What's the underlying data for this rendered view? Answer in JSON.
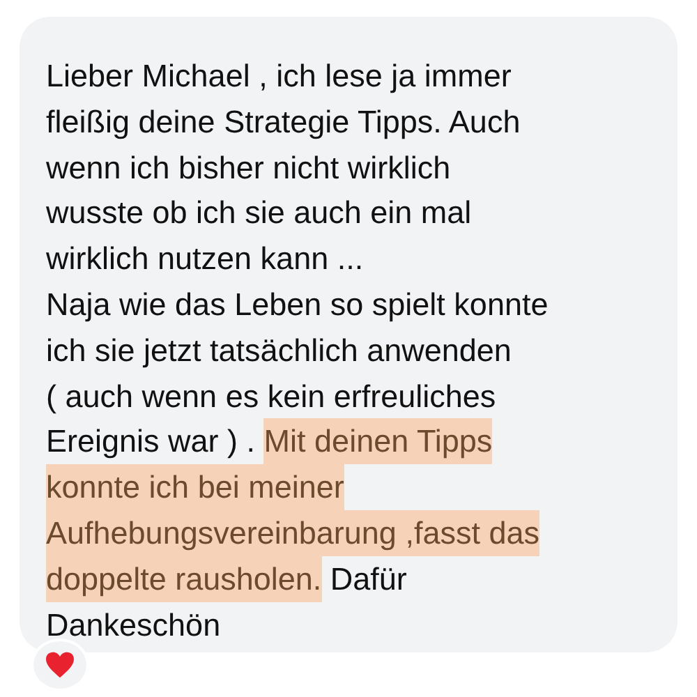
{
  "message": {
    "lines": [
      [
        {
          "text": "Lieber Michael , ich lese ja immer",
          "highlighted": false
        }
      ],
      [
        {
          "text": "fleißig deine Strategie Tipps. Auch",
          "highlighted": false
        }
      ],
      [
        {
          "text": "wenn ich bisher nicht wirklich",
          "highlighted": false
        }
      ],
      [
        {
          "text": "wusste ob ich sie auch ein mal",
          "highlighted": false
        }
      ],
      [
        {
          "text": "wirklich nutzen kann ...",
          "highlighted": false
        }
      ],
      [
        {
          "text": "Naja wie das Leben so spielt konnte",
          "highlighted": false
        }
      ],
      [
        {
          "text": "ich sie jetzt tatsächlich anwenden",
          "highlighted": false
        }
      ],
      [
        {
          "text": "( auch wenn es kein erfreuliches",
          "highlighted": false
        }
      ],
      [
        {
          "text": "Ereignis war ) . ",
          "highlighted": false
        },
        {
          "text": "Mit deinen Tipps ",
          "highlighted": true
        }
      ],
      [
        {
          "text": "konnte ich bei meiner",
          "highlighted": true
        }
      ],
      [
        {
          "text": "Aufhebungsvereinbarung ,fasst das",
          "highlighted": true
        }
      ],
      [
        {
          "text": "doppelte rausholen.",
          "highlighted": true
        },
        {
          "text": " Dafür",
          "highlighted": false
        }
      ],
      [
        {
          "text": "Dankeschön",
          "highlighted": false
        }
      ]
    ]
  }
}
